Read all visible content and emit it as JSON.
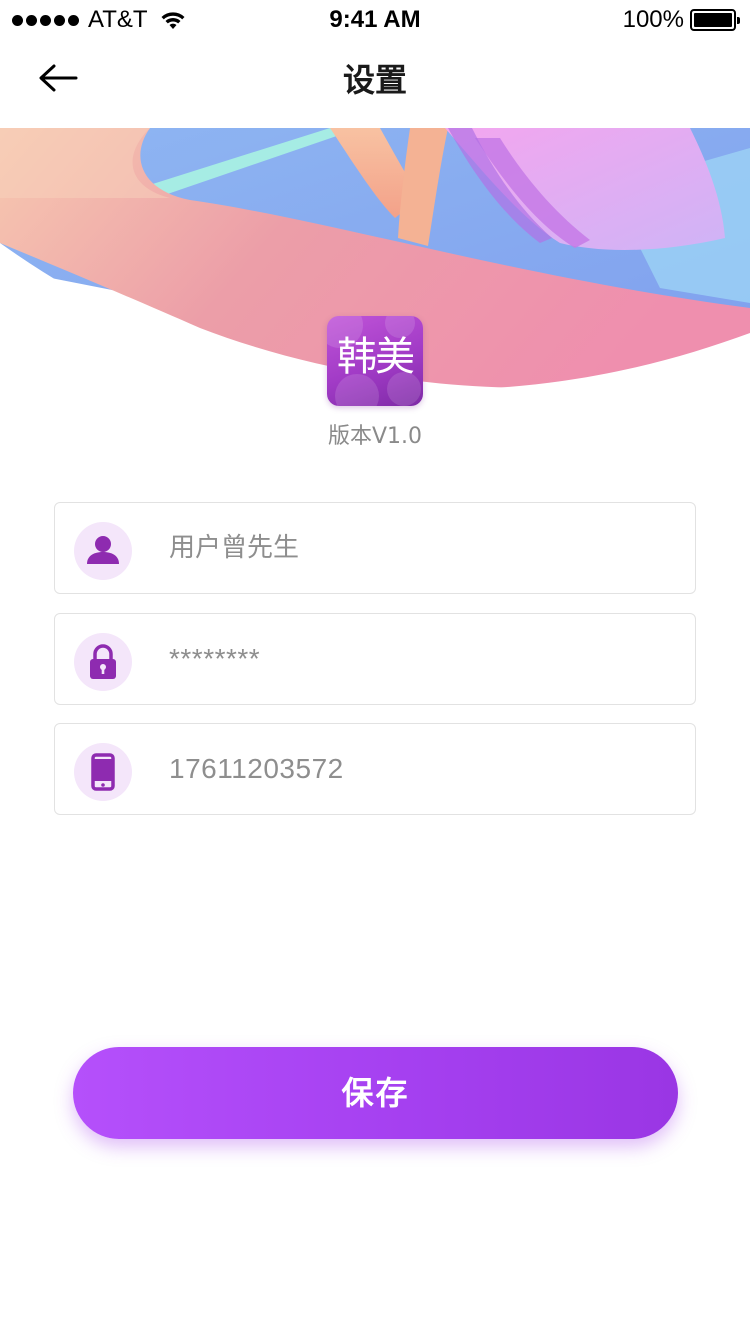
{
  "status_bar": {
    "carrier": "AT&T",
    "time": "9:41 AM",
    "battery": "100%"
  },
  "nav": {
    "title": "设置",
    "back_icon": "arrow-left-icon"
  },
  "app": {
    "logo_text": "韩美",
    "version": "版本V1.0"
  },
  "form": {
    "username": {
      "icon": "user-icon",
      "value": "用户曾先生"
    },
    "password": {
      "icon": "lock-icon",
      "value": "********"
    },
    "phone": {
      "icon": "phone-icon",
      "value": "17611203572"
    }
  },
  "save_button": {
    "label": "保存"
  },
  "colors": {
    "accent": "#a540f0",
    "icon_purple": "#8e2bb0",
    "icon_bg": "#f4e6fa"
  }
}
